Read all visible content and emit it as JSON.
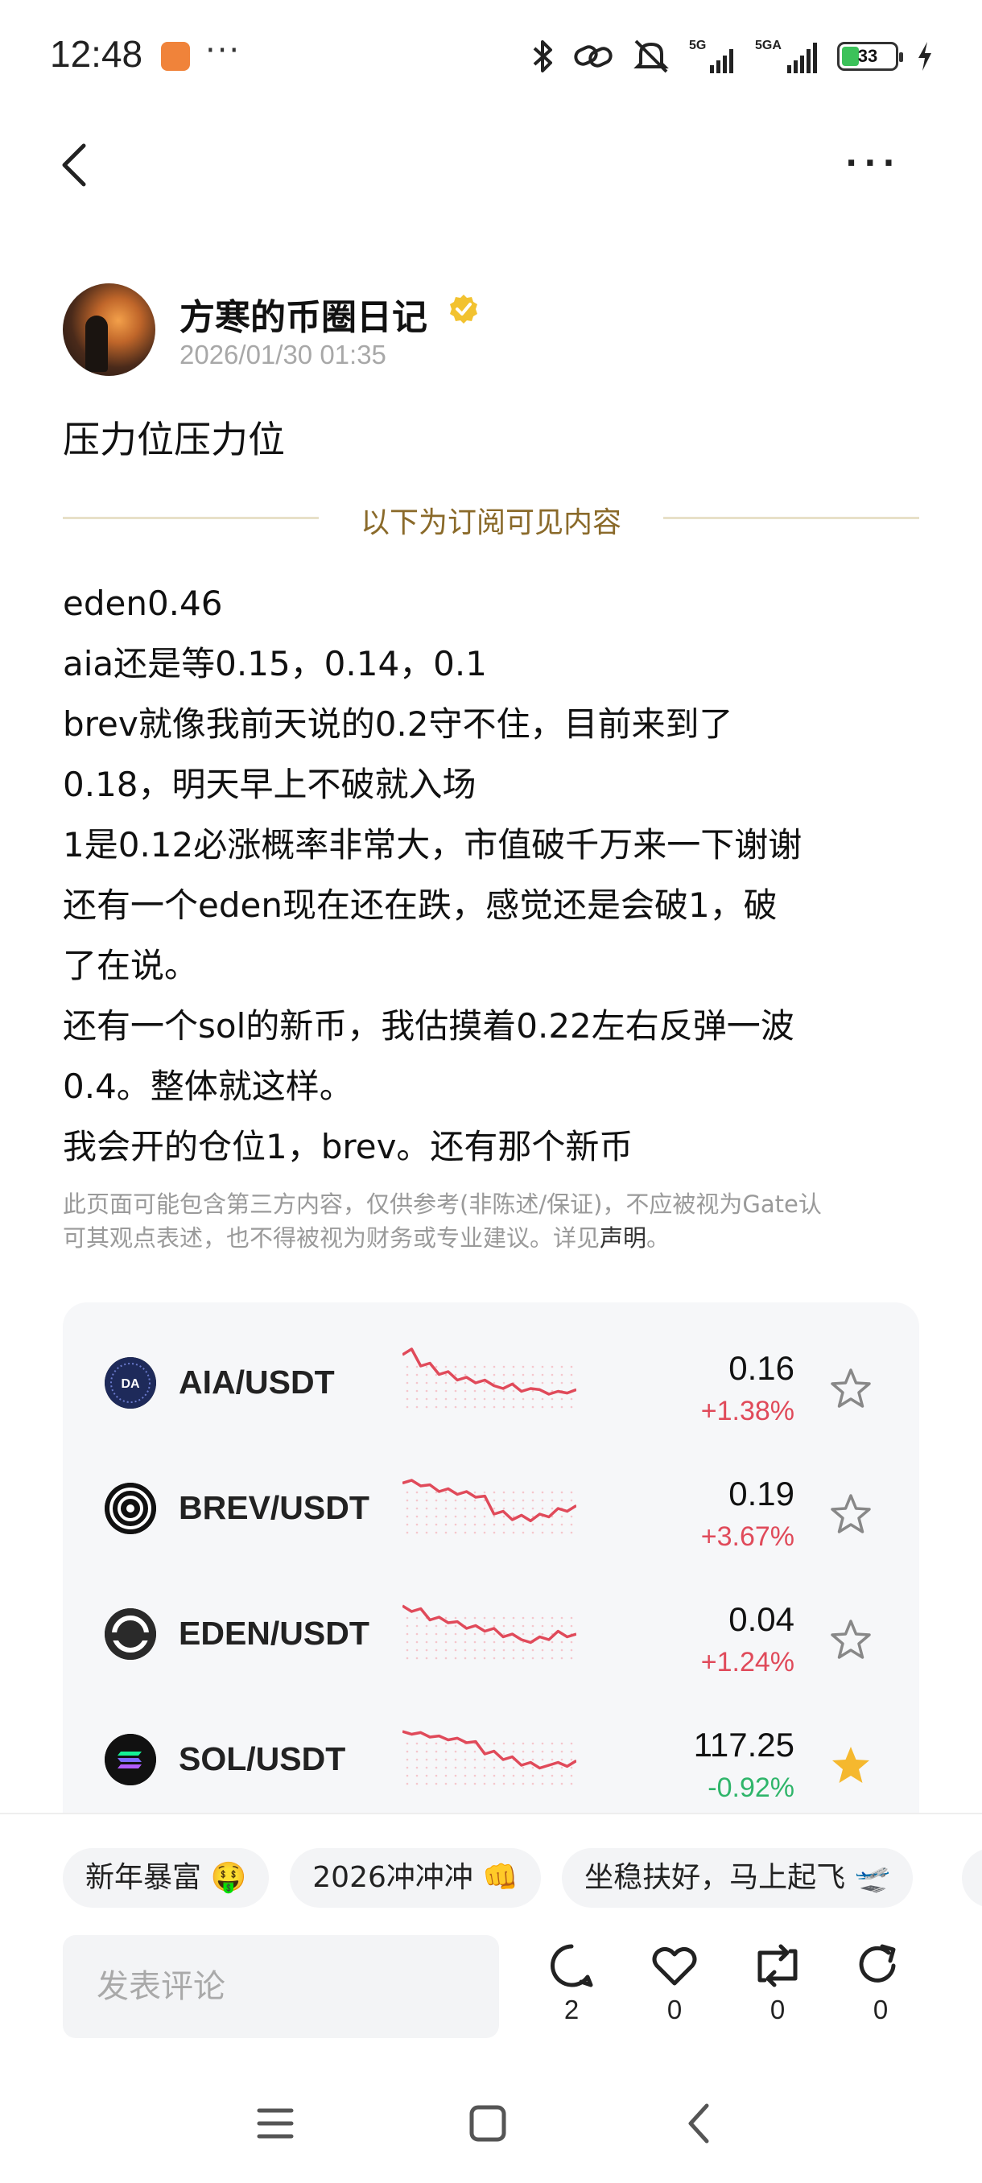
{
  "status_bar": {
    "time": "12:48",
    "more": "···",
    "network_1": "5G",
    "network_2": "5GA",
    "battery": "33",
    "battery_level": 0.33,
    "icons": [
      "bluetooth-icon",
      "link-icon",
      "mute-icon",
      "signal-icon",
      "battery-icon",
      "charging-icon"
    ]
  },
  "nav": {
    "more": "···"
  },
  "author": {
    "name": "方寒的币圈日记",
    "date": "2026/01/30 01:35"
  },
  "post": {
    "title": "压力位压力位",
    "subscribe_divider": "以下为订阅可见内容",
    "lines": [
      "eden0.46",
      "aia还是等0.15，0.14，0.1",
      "brev就像我前天说的0.2守不住，目前来到了",
      "0.18，明天早上不破就入场",
      "1是0.12必涨概率非常大，市值破千万来一下谢谢",
      "还有一个eden现在还在跌，感觉还是会破1，破",
      "了在说。",
      "还有一个sol的新币，我估摸着0.22左右反弹一波",
      "0.4。整体就这样。",
      "我会开的仓位1，brev。还有那个新币"
    ],
    "disclaimer_line1": "此页面可能包含第三方内容，仅供参考(非陈述/保证)，不应被视为Gate认",
    "disclaimer_line2": "可其观点表述，也不得被视为财务或专业建议。详见",
    "disclaimer_link": "声明",
    "disclaimer_end": "。"
  },
  "market": {
    "colors": {
      "up": "#e04a5a",
      "down": "#2fb56a",
      "star_active": "#f5b82e"
    },
    "pairs": [
      {
        "name": "AIA/USDT",
        "price": "0.16",
        "change": "+1.38%",
        "direction": "up",
        "favorited": false,
        "logo": "aia-logo",
        "spark": [
          0.9,
          1.0,
          0.7,
          0.75,
          0.55,
          0.6,
          0.45,
          0.5,
          0.4,
          0.45,
          0.35,
          0.3,
          0.38,
          0.25,
          0.3,
          0.28,
          0.2,
          0.25,
          0.22,
          0.28
        ]
      },
      {
        "name": "BREV/USDT",
        "price": "0.19",
        "change": "+3.67%",
        "direction": "up",
        "favorited": false,
        "logo": "brev-logo",
        "spark": [
          0.85,
          0.9,
          0.8,
          0.82,
          0.7,
          0.75,
          0.65,
          0.7,
          0.6,
          0.62,
          0.3,
          0.35,
          0.2,
          0.28,
          0.18,
          0.3,
          0.25,
          0.4,
          0.35,
          0.45
        ]
      },
      {
        "name": "EDEN/USDT",
        "price": "0.04",
        "change": "+1.24%",
        "direction": "up",
        "favorited": false,
        "logo": "eden-logo",
        "spark": [
          0.9,
          0.8,
          0.85,
          0.65,
          0.7,
          0.6,
          0.62,
          0.5,
          0.55,
          0.45,
          0.5,
          0.35,
          0.4,
          0.3,
          0.25,
          0.35,
          0.3,
          0.45,
          0.35,
          0.4
        ]
      },
      {
        "name": "SOL/USDT",
        "price": "117.25",
        "change": "-0.92%",
        "direction": "down",
        "favorited": true,
        "logo": "sol-logo",
        "spark": [
          0.9,
          0.85,
          0.88,
          0.8,
          0.82,
          0.75,
          0.78,
          0.7,
          0.72,
          0.5,
          0.55,
          0.4,
          0.45,
          0.3,
          0.35,
          0.25,
          0.3,
          0.35,
          0.28,
          0.38
        ]
      }
    ]
  },
  "tags": [
    "新年暴富 🤑",
    "2026冲冲冲 👊",
    "坐稳扶好，马上起飞 🛫"
  ],
  "comment": {
    "placeholder": "发表评论"
  },
  "actions": [
    {
      "name": "comment",
      "count": "2"
    },
    {
      "name": "like",
      "count": "0"
    },
    {
      "name": "repost",
      "count": "0"
    },
    {
      "name": "share",
      "count": "0"
    }
  ]
}
